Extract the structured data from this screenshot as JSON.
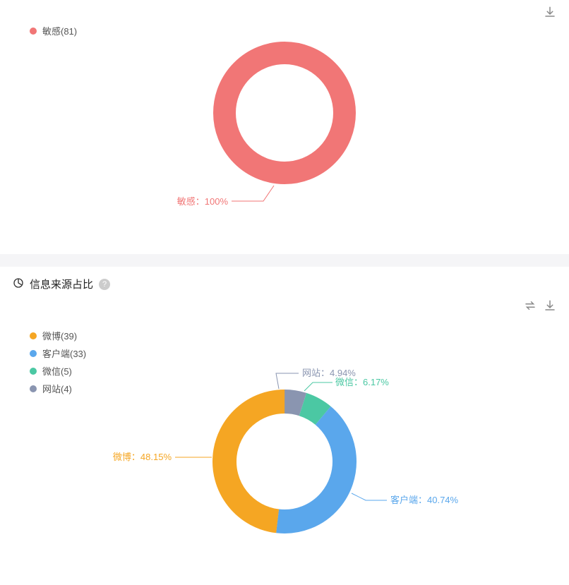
{
  "chart_data": [
    {
      "type": "pie",
      "title": "",
      "series": [
        {
          "name": "敏感",
          "value": 81,
          "percent": 100,
          "color": "#f17676"
        }
      ],
      "percent_label": "敏感：100%"
    },
    {
      "type": "pie",
      "title": "信息来源占比",
      "series": [
        {
          "name": "微博",
          "value": 39,
          "percent": 48.15,
          "color": "#f5a623"
        },
        {
          "name": "客户端",
          "value": 33,
          "percent": 40.74,
          "color": "#5aa7ec"
        },
        {
          "name": "微信",
          "value": 5,
          "percent": 6.17,
          "color": "#4bc8a3"
        },
        {
          "name": "网站",
          "value": 4,
          "percent": 4.94,
          "color": "#8a95b0"
        }
      ],
      "labels": {
        "weibo": "微博：48.15%",
        "client": "客户端：40.74%",
        "wechat": "微信：6.17%",
        "website": "网站：4.94%"
      }
    }
  ],
  "section2": {
    "title": "信息来源占比",
    "help": "?"
  },
  "legend1": {
    "item0": "敏感(81)"
  },
  "legend2": {
    "item0": "微博(39)",
    "item1": "客户端(33)",
    "item2": "微信(5)",
    "item3": "网站(4)"
  }
}
